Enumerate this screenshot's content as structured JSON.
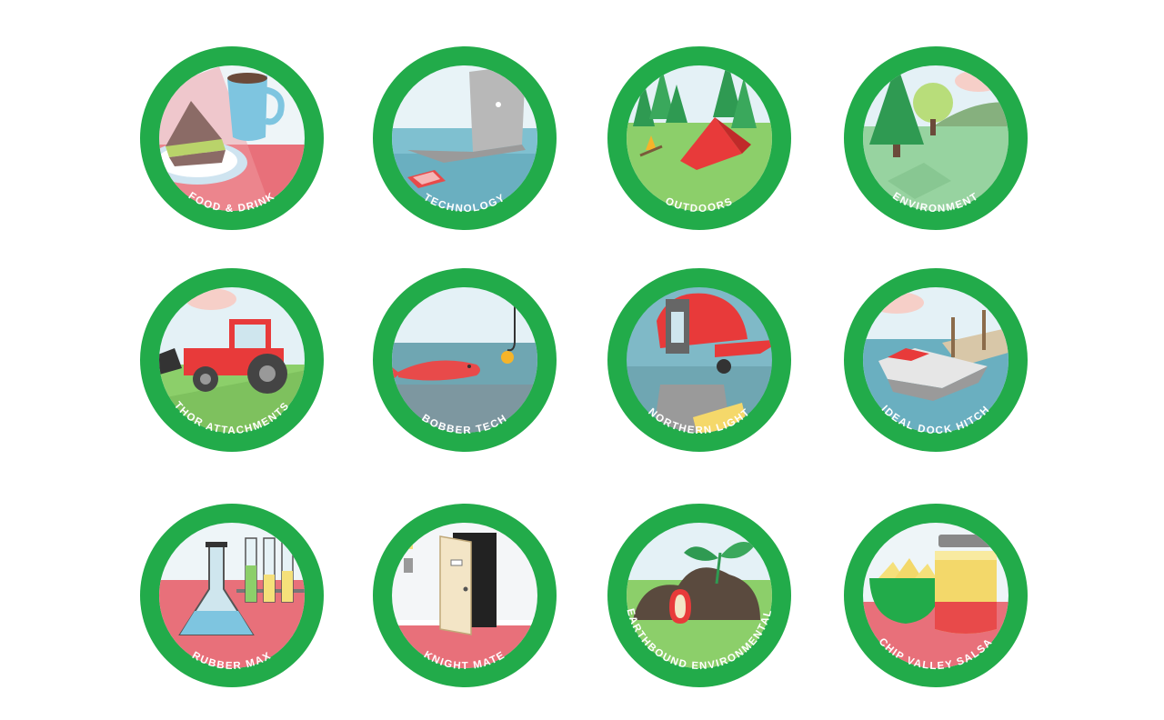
{
  "colors": {
    "ring": "#22ab4a",
    "sky": "#d8ecf2",
    "ground_green": "#8ccf6a",
    "table_pink": "#e8707a",
    "water": "#7fb9c7",
    "label_text": "#ffffff"
  },
  "badges": [
    {
      "id": "food-drink",
      "label": "FOOD & DRINK",
      "icon": "coffee-sandwich-icon"
    },
    {
      "id": "technology",
      "label": "TECHNOLOGY",
      "icon": "laptop-icon"
    },
    {
      "id": "outdoors",
      "label": "OUTDOORS",
      "icon": "tent-campfire-icon"
    },
    {
      "id": "environment",
      "label": "ENVIRONMENT",
      "icon": "trees-hills-icon"
    },
    {
      "id": "thor-attachments",
      "label": "THOR ATTACHMENTS",
      "icon": "tractor-icon"
    },
    {
      "id": "bobber-tech",
      "label": "BOBBER TECH",
      "icon": "fish-hook-icon"
    },
    {
      "id": "northern-light",
      "label": "NORTHERN LIGHT",
      "icon": "firefighter-helmet-icon"
    },
    {
      "id": "ideal-dock-hitch",
      "label": "IDEAL DOCK HITCH",
      "icon": "boat-dock-icon"
    },
    {
      "id": "rubber-max",
      "label": "RUBBER MAX",
      "icon": "lab-flask-icon"
    },
    {
      "id": "knight-mate",
      "label": "KNIGHT MATE",
      "icon": "open-door-icon"
    },
    {
      "id": "earthbound-environmental",
      "label": "EARTHBOUND ENVIRONMENTAL",
      "icon": "compost-sprout-icon"
    },
    {
      "id": "chip-valley-salsa",
      "label": "CHIP VALLEY SALSA",
      "icon": "chips-salsa-jar-icon"
    }
  ]
}
